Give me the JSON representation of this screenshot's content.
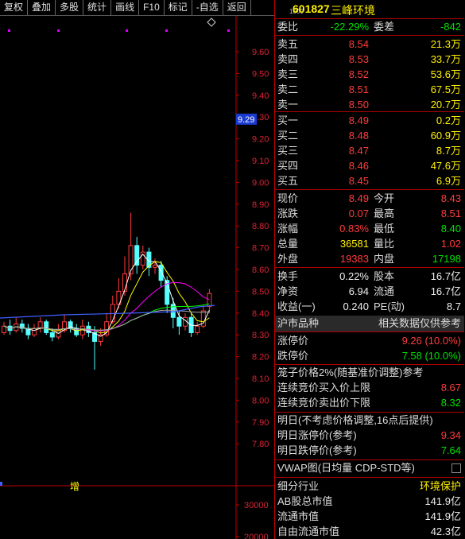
{
  "toolbar": [
    "复权",
    "叠加",
    "多股",
    "统计",
    "画线",
    "F10",
    "标记",
    "-自选",
    "返回"
  ],
  "header": {
    "code_prefix": "1000",
    "code": "601827",
    "name": "三峰环境"
  },
  "weibi": {
    "label": "委比",
    "value": "-22.29%",
    "label2": "委差",
    "value2": "-842"
  },
  "sell": [
    {
      "label": "卖五",
      "price": "8.54",
      "vol": "21.3万"
    },
    {
      "label": "卖四",
      "price": "8.53",
      "vol": "33.7万"
    },
    {
      "label": "卖三",
      "price": "8.52",
      "vol": "53.6万"
    },
    {
      "label": "卖二",
      "price": "8.51",
      "vol": "67.5万"
    },
    {
      "label": "卖一",
      "price": "8.50",
      "vol": "20.7万"
    }
  ],
  "buy": [
    {
      "label": "买一",
      "price": "8.49",
      "vol": "0.2万"
    },
    {
      "label": "买二",
      "price": "8.48",
      "vol": "60.9万"
    },
    {
      "label": "买三",
      "price": "8.47",
      "vol": "8.7万"
    },
    {
      "label": "买四",
      "price": "8.46",
      "vol": "47.6万"
    },
    {
      "label": "买五",
      "price": "8.45",
      "vol": "6.9万"
    }
  ],
  "quote": [
    {
      "l1": "现价",
      "v1": "8.49",
      "l2": "今开",
      "v2": "8.43",
      "c1": "red",
      "c2": "red"
    },
    {
      "l1": "涨跌",
      "v1": "0.07",
      "l2": "最高",
      "v2": "8.51",
      "c1": "red",
      "c2": "red"
    },
    {
      "l1": "涨幅",
      "v1": "0.83%",
      "l2": "最低",
      "v2": "8.40",
      "c1": "red",
      "c2": "green"
    },
    {
      "l1": "总量",
      "v1": "36581",
      "l2": "量比",
      "v2": "1.02",
      "c1": "yellow",
      "c2": "red"
    },
    {
      "l1": "外盘",
      "v1": "19383",
      "l2": "内盘",
      "v2": "17198",
      "c1": "red",
      "c2": "green"
    }
  ],
  "fin": [
    {
      "l1": "换手",
      "v1": "0.22%",
      "l2": "股本",
      "v2": "16.7亿"
    },
    {
      "l1": "净资",
      "v1": "6.94",
      "l2": "流通",
      "v2": "16.7亿"
    },
    {
      "l1": "收益(一)",
      "v1": "0.240",
      "l2": "PE(动)",
      "v2": "8.7"
    }
  ],
  "market": {
    "left": "沪市品种",
    "right": "相关数据仅供参考"
  },
  "limits": [
    {
      "label": "涨停价",
      "value": "9.26 (10.0%)",
      "color": "red"
    },
    {
      "label": "跌停价",
      "value": "7.58 (10.0%)",
      "color": "green"
    }
  ],
  "cage": {
    "title": "笼子价格2%(随基准价调整)参考",
    "rows": [
      {
        "label": "连续竞价买入价上限",
        "value": "8.67",
        "color": "red"
      },
      {
        "label": "连续竞价卖出价下限",
        "value": "8.32",
        "color": "green"
      }
    ]
  },
  "tomorrow": {
    "title": "明日(不考虑价格调整,16点后提供)",
    "rows": [
      {
        "label": "明日涨停价(参考)",
        "value": "9.34",
        "color": "red"
      },
      {
        "label": "明日跌停价(参考)",
        "value": "7.64",
        "color": "green"
      }
    ]
  },
  "vwap": {
    "label": "VWAP图(日均量 CDP-STD等)"
  },
  "industry": [
    {
      "label": "细分行业",
      "value": "环境保护",
      "color": "yellow"
    },
    {
      "label": "AB股总市值",
      "value": "141.9亿",
      "color": "white"
    },
    {
      "label": "流通市值",
      "value": "141.9亿",
      "color": "white"
    },
    {
      "label": "自由流通市值",
      "value": "42.3亿",
      "color": "white"
    }
  ],
  "chart_data": {
    "type": "candlestick",
    "y_ticks": [
      "9.60",
      "9.50",
      "9.40",
      "9.30",
      "9.20",
      "9.10",
      "9.00",
      "8.90",
      "8.80",
      "8.70",
      "8.60",
      "8.50",
      "8.40",
      "8.30",
      "8.20",
      "8.10",
      "8.00",
      "7.90",
      "7.80"
    ],
    "price_marker": "9.29",
    "volume_ticks": [
      "30000",
      "20000"
    ],
    "zeng_label": "增",
    "ylim": [
      7.75,
      9.67
    ],
    "candles": [
      [
        8.31,
        8.34,
        8.36,
        8.3
      ],
      [
        8.34,
        8.32,
        8.37,
        8.3
      ],
      [
        8.32,
        8.35,
        8.38,
        8.31
      ],
      [
        8.35,
        8.33,
        8.37,
        8.31
      ],
      [
        8.33,
        8.3,
        8.35,
        8.28
      ],
      [
        8.3,
        8.33,
        8.35,
        8.29
      ],
      [
        8.33,
        8.36,
        8.38,
        8.31
      ],
      [
        8.36,
        8.31,
        8.37,
        8.3
      ],
      [
        8.31,
        8.29,
        8.33,
        8.27
      ],
      [
        8.29,
        8.32,
        8.35,
        8.28
      ],
      [
        8.32,
        8.36,
        8.39,
        8.31
      ],
      [
        8.36,
        8.33,
        8.37,
        8.31
      ],
      [
        8.33,
        8.3,
        8.35,
        8.29
      ],
      [
        8.3,
        8.34,
        8.37,
        8.28
      ],
      [
        8.34,
        8.31,
        8.36,
        8.29
      ],
      [
        8.31,
        8.27,
        8.34,
        8.14
      ],
      [
        8.27,
        8.3,
        8.33,
        8.25
      ],
      [
        8.3,
        8.36,
        8.4,
        8.29
      ],
      [
        8.36,
        8.44,
        8.48,
        8.35
      ],
      [
        8.44,
        8.5,
        8.56,
        8.42
      ],
      [
        8.5,
        8.58,
        8.66,
        8.48
      ],
      [
        8.58,
        8.71,
        8.86,
        8.55
      ],
      [
        8.71,
        8.62,
        8.75,
        8.58
      ],
      [
        8.62,
        8.68,
        8.71,
        8.6
      ],
      [
        8.68,
        8.61,
        8.7,
        8.57
      ],
      [
        8.61,
        8.62,
        8.65,
        8.58
      ],
      [
        8.62,
        8.55,
        8.64,
        8.52
      ],
      [
        8.55,
        8.44,
        8.57,
        8.4
      ],
      [
        8.44,
        8.38,
        8.47,
        8.33
      ],
      [
        8.38,
        8.34,
        8.41,
        8.3
      ],
      [
        8.34,
        8.38,
        8.4,
        8.32
      ],
      [
        8.38,
        8.31,
        8.4,
        8.29
      ],
      [
        8.31,
        8.34,
        8.36,
        8.3
      ],
      [
        8.34,
        8.41,
        8.44,
        8.33
      ],
      [
        8.43,
        8.49,
        8.51,
        8.4
      ]
    ]
  }
}
